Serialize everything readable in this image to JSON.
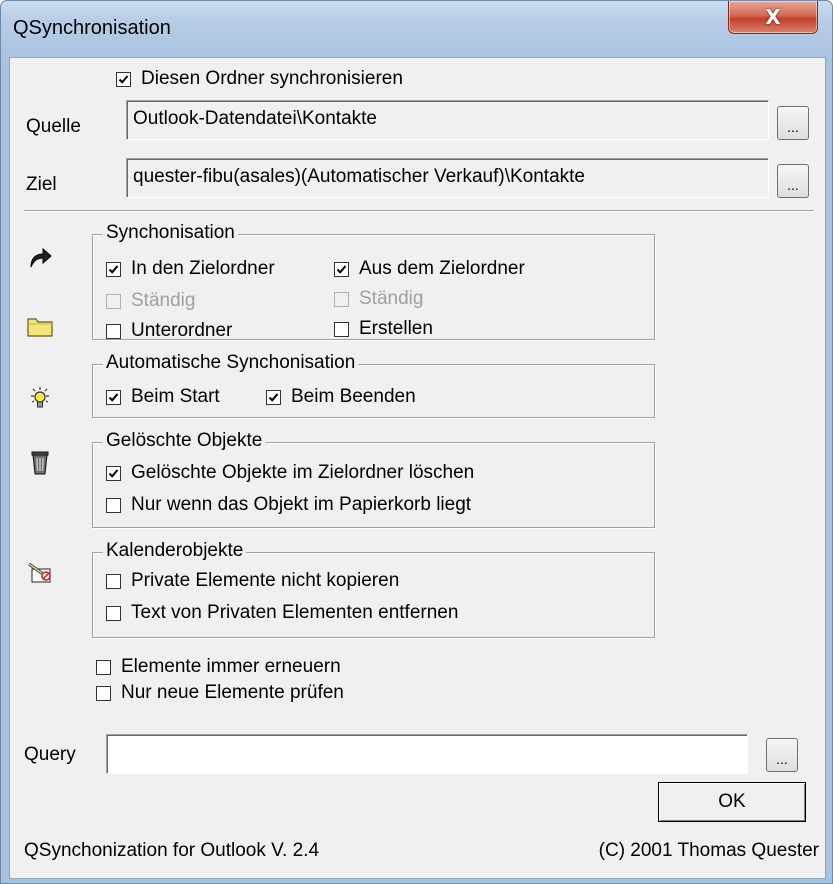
{
  "window": {
    "title": "QSynchronisation",
    "close_glyph": "X"
  },
  "dialog": {
    "sync_folder_label": "Diesen Ordner synchronisieren",
    "sync_folder_checked": true,
    "source": {
      "label": "Quelle",
      "value": "Outlook-Datendatei\\Kontakte",
      "browse": "..."
    },
    "target": {
      "label": "Ziel",
      "value": "quester-fibu(asales)(Automatischer Verkauf)\\Kontakte",
      "browse": "..."
    },
    "sync_group": {
      "title": "Synchonisation",
      "to_target": {
        "label": "In den Zielordner",
        "checked": true
      },
      "from_target": {
        "label": "Aus dem Zielordner",
        "checked": true
      },
      "to_permanent": {
        "label": "Ständig",
        "checked": false,
        "disabled": true
      },
      "from_permanent": {
        "label": "Ständig",
        "checked": false,
        "disabled": true
      },
      "subfolders": {
        "label": "Unterordner",
        "checked": false
      },
      "create": {
        "label": "Erstellen",
        "checked": false
      }
    },
    "auto_group": {
      "title": "Automatische Synchonisation",
      "on_start": {
        "label": "Beim Start",
        "checked": true
      },
      "on_exit": {
        "label": "Beim Beenden",
        "checked": true
      }
    },
    "deleted_group": {
      "title": "Gelöschte Objekte",
      "delete_in_target": {
        "label": "Gelöschte Objekte im Zielordner löschen",
        "checked": true
      },
      "only_recycle": {
        "label": "Nur wenn das Objekt im Papierkorb liegt",
        "checked": false
      }
    },
    "calendar_group": {
      "title": "Kalenderobjekte",
      "no_private": {
        "label": "Private Elemente nicht kopieren",
        "checked": false
      },
      "strip_private_text": {
        "label": "Text von Privaten Elementen entfernen",
        "checked": false
      }
    },
    "always_renew": {
      "label": "Elemente immer erneuern",
      "checked": false
    },
    "only_new": {
      "label": "Nur neue Elemente prüfen",
      "checked": false
    },
    "query": {
      "label": "Query",
      "value": "",
      "browse": "..."
    },
    "ok_label": "OK",
    "footer_left": "QSynchonization for Outlook V. 2.4",
    "footer_right": "(C) 2001 Thomas Quester"
  },
  "icons": {
    "sync": "arrow-redo-icon",
    "folder": "folder-icon",
    "auto": "lightbulb-icon",
    "deleted": "trash-icon",
    "calendar": "calendar-private-icon"
  },
  "colors": {
    "dialog_bg": "#f0f0f0",
    "title_bar": "#b7cde6",
    "close_button": "#c0402a",
    "disabled_text": "#a0a0a0"
  }
}
